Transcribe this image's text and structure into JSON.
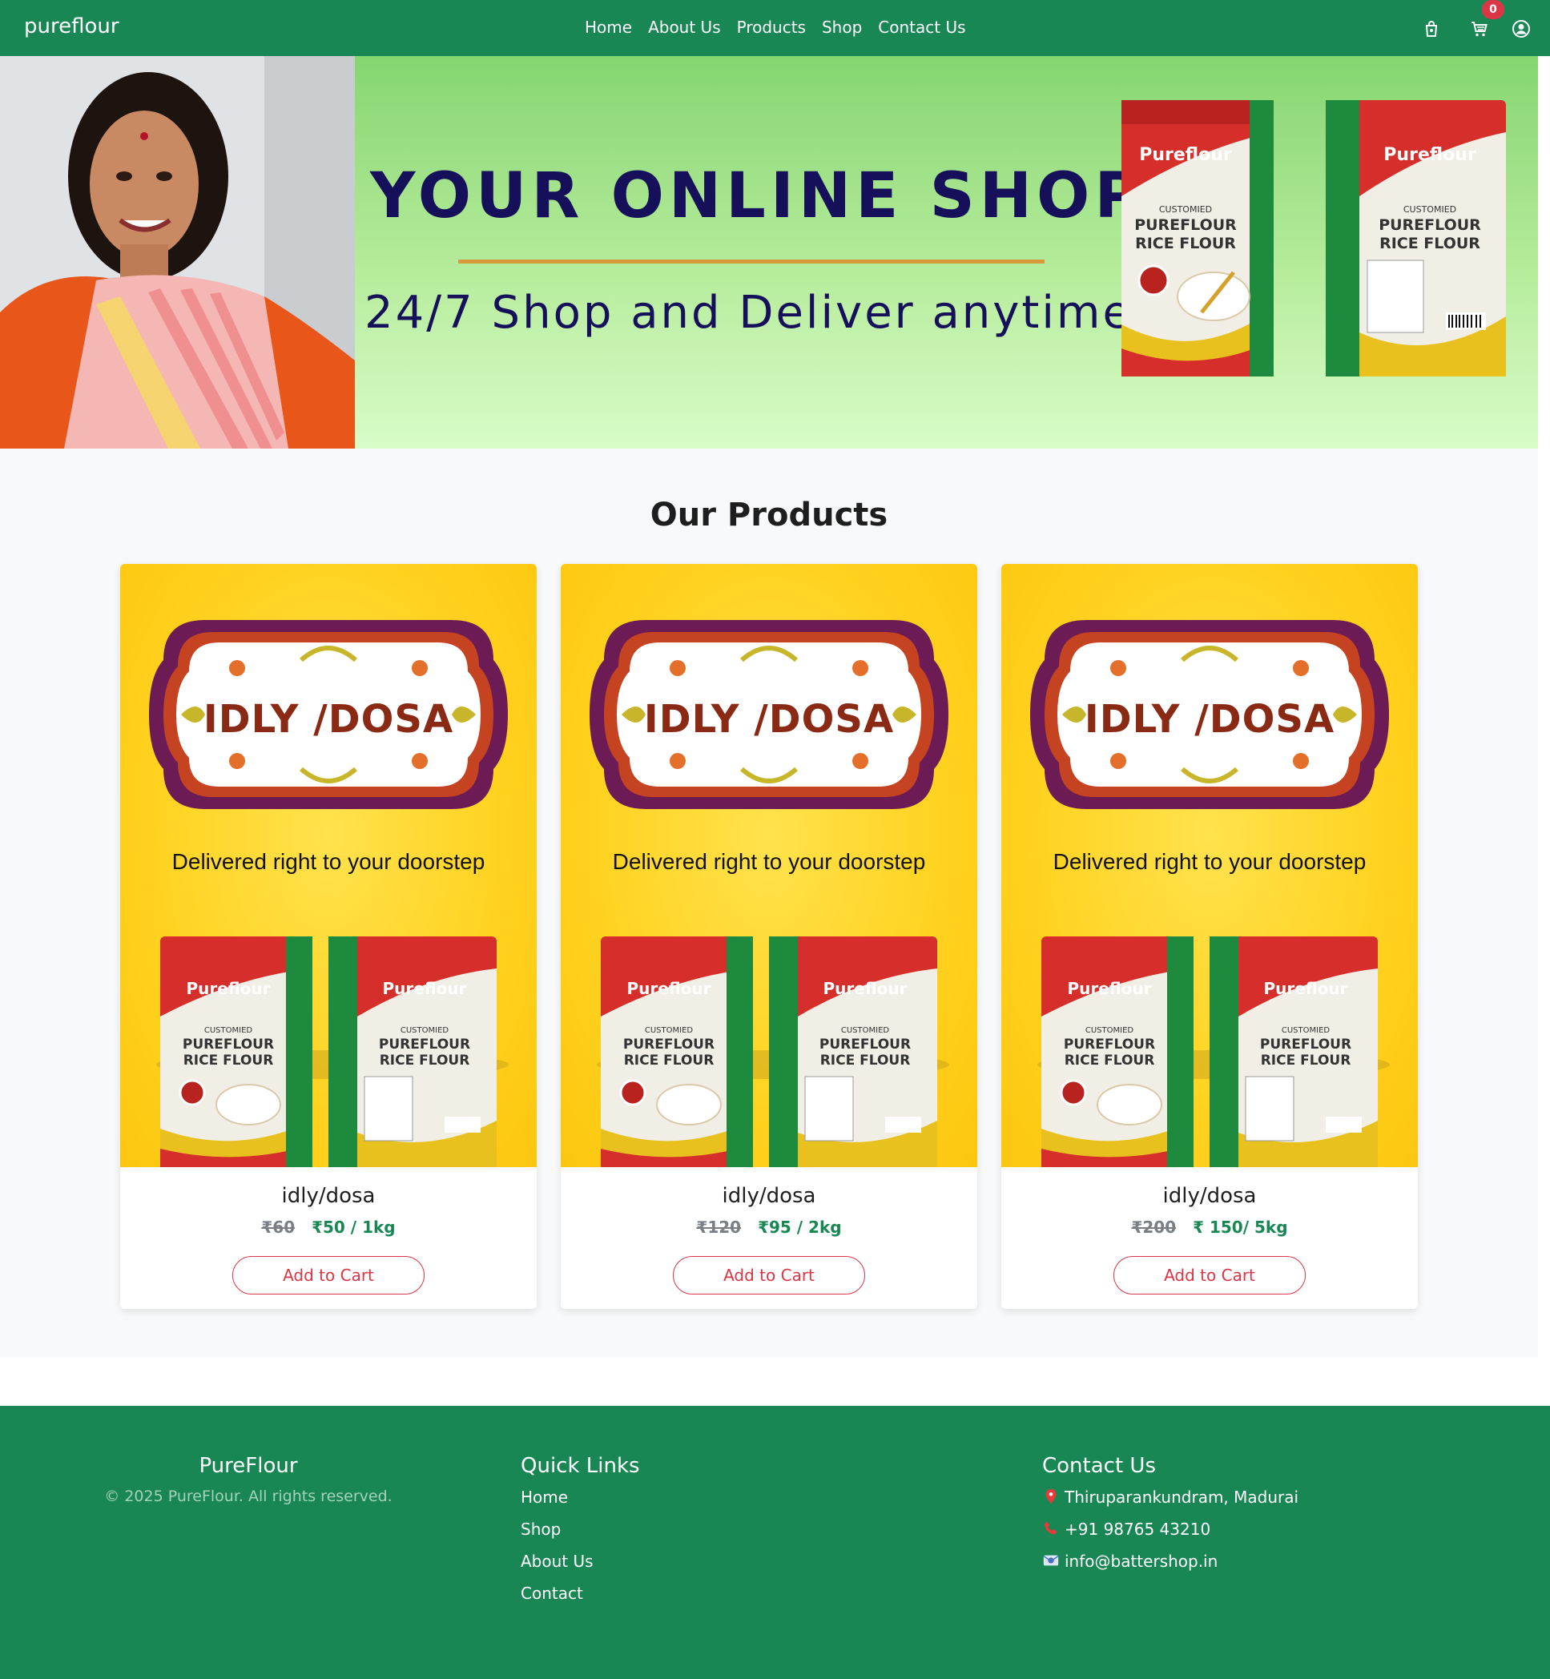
{
  "nav": {
    "brand": "pureflour",
    "links": [
      "Home",
      "About Us",
      "Products",
      "Shop",
      "Contact Us"
    ],
    "cart_count": "0",
    "icons": [
      "bag-icon",
      "cart-icon",
      "user-icon"
    ]
  },
  "hero": {
    "title": "YOUR ONLINE SHOP",
    "subtitle": "24/7 Shop and Deliver anytime!",
    "pack_brand": "Pureflour",
    "pack_customized": "CUSTOMIED",
    "pack_line1": "PUREFLOUR",
    "pack_line2": "RICE FLOUR"
  },
  "products": {
    "heading": "Our Products",
    "items": [
      {
        "label": "IDLY /DOSA",
        "tagline": "Delivered right to your doorstep",
        "name": "idly/dosa",
        "old_price": "₹60",
        "new_price": "₹50 / 1kg",
        "button": "Add to Cart"
      },
      {
        "label": "IDLY /DOSA",
        "tagline": "Delivered right to your doorstep",
        "name": "idly/dosa",
        "old_price": "₹120",
        "new_price": "₹95 / 2kg",
        "button": "Add to Cart"
      },
      {
        "label": "IDLY /DOSA",
        "tagline": "Delivered right to your doorstep",
        "name": "idly/dosa",
        "old_price": "₹200",
        "new_price": "₹ 150/ 5kg",
        "button": "Add to Cart"
      }
    ]
  },
  "footer": {
    "brand": "PureFlour",
    "copyright": "© 2025 PureFlour. All rights reserved.",
    "quick_links_title": "Quick Links",
    "quick_links": [
      "Home",
      "Shop",
      "About Us",
      "Contact"
    ],
    "contact_title": "Contact Us",
    "address": "Thiruparankundram, Madurai",
    "phone": "+91 98765 43210",
    "email": "info@battershop.in"
  },
  "colors": {
    "primary_green": "#198754",
    "danger_red": "#dc3545",
    "hero_navy": "#16105a",
    "card_yellow": "#ffd21f"
  }
}
